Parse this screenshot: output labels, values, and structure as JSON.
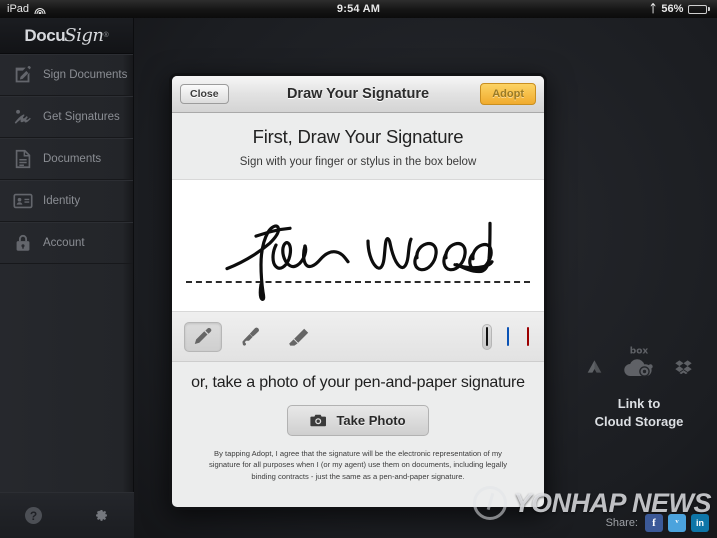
{
  "status_bar": {
    "device": "iPad",
    "wifi_icon": "wifi-icon",
    "time": "9:54 AM",
    "bluetooth_icon": "bluetooth-icon",
    "battery_percent": "56%",
    "battery_icon": "battery-icon"
  },
  "sidebar": {
    "logo": {
      "part1": "Docu",
      "part2": "Sign",
      "trademark": "®"
    },
    "items": [
      {
        "label": "Sign Documents",
        "icon": "sign-document-icon"
      },
      {
        "label": "Get Signatures",
        "icon": "get-signatures-icon"
      },
      {
        "label": "Documents",
        "icon": "documents-icon"
      },
      {
        "label": "Identity",
        "icon": "identity-card-icon"
      },
      {
        "label": "Account",
        "icon": "lock-icon"
      }
    ],
    "bottom": {
      "help_label": "?",
      "help_icon": "help-icon",
      "settings_icon": "gear-icon"
    }
  },
  "cloud_widget": {
    "line1": "Link to",
    "line2": "Cloud Storage",
    "icons": [
      "google-drive-icon",
      "box-icon",
      "cloud-settings-icon",
      "dropbox-icon"
    ]
  },
  "share": {
    "label": "Share:",
    "buttons": [
      {
        "name": "facebook",
        "glyph": "f"
      },
      {
        "name": "twitter",
        "glyph": "ᵛ"
      },
      {
        "name": "linkedin",
        "glyph": "in"
      }
    ]
  },
  "watermark": {
    "text": "YONHAP NEWS"
  },
  "modal": {
    "close_label": "Close",
    "title": "Draw Your Signature",
    "adopt_label": "Adopt",
    "intro_heading": "First, Draw Your Signature",
    "intro_subtitle": "Sign with your finger or stylus in the box below",
    "signature_value": "Tom Wood",
    "tools": [
      {
        "name": "pen-tool",
        "selected": true
      },
      {
        "name": "brush-tool",
        "selected": false
      },
      {
        "name": "highlighter-tool",
        "selected": false
      }
    ],
    "colors": [
      {
        "name": "black",
        "hex": "#2a2a2a",
        "selected": true
      },
      {
        "name": "blue",
        "hex": "#0a72e8",
        "selected": false
      },
      {
        "name": "red",
        "hex": "#d40000",
        "selected": false
      }
    ],
    "photo_heading": "or, take a photo of your pen-and-paper signature",
    "take_photo_label": "Take Photo",
    "take_photo_icon": "camera-icon",
    "legal_text": "By tapping Adopt, I agree that the signature will be the electronic representation of my signature for all purposes when I (or my agent) use them on documents, including legally binding contracts - just the same as a pen-and-paper signature."
  },
  "theme": {
    "accent_gold": "#f0ab2e",
    "sidebar_bg": "#26282d",
    "modal_bg": "#eceded"
  }
}
